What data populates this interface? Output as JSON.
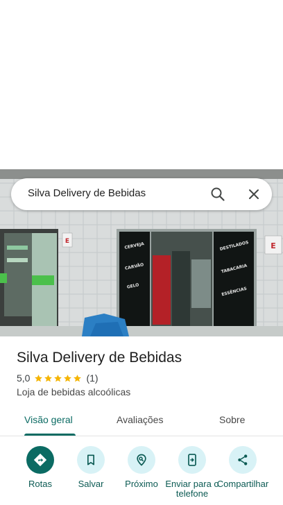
{
  "search": {
    "query": "Silva Delivery de Bebidas"
  },
  "place": {
    "name": "Silva Delivery de Bebidas",
    "rating": "5,0",
    "star_count": 5,
    "reviews_count": "(1)",
    "category": "Loja de bebidas alcoólicas"
  },
  "photo_signs": {
    "left_door": [
      "CERVEJA",
      "CARVÃO",
      "GELO"
    ],
    "right_door": [
      "DESTILADOS",
      "TABACARIA",
      "ESSÊNCIAS"
    ],
    "badge": "E"
  },
  "tabs": [
    {
      "label": "Visão geral",
      "active": true
    },
    {
      "label": "Avaliações",
      "active": false
    },
    {
      "label": "Sobre",
      "active": false
    }
  ],
  "actions": [
    {
      "label": "Rotas",
      "icon": "directions-icon"
    },
    {
      "label": "Salvar",
      "icon": "bookmark-icon"
    },
    {
      "label": "Próximo",
      "icon": "nearby-icon"
    },
    {
      "label": "Enviar para o telefone",
      "icon": "send-to-phone-icon"
    },
    {
      "label": "Compartilhar",
      "icon": "share-icon"
    }
  ],
  "colors": {
    "accent": "#0b6b63",
    "action_bg": "#d8f2f6",
    "star": "#f5b400"
  }
}
